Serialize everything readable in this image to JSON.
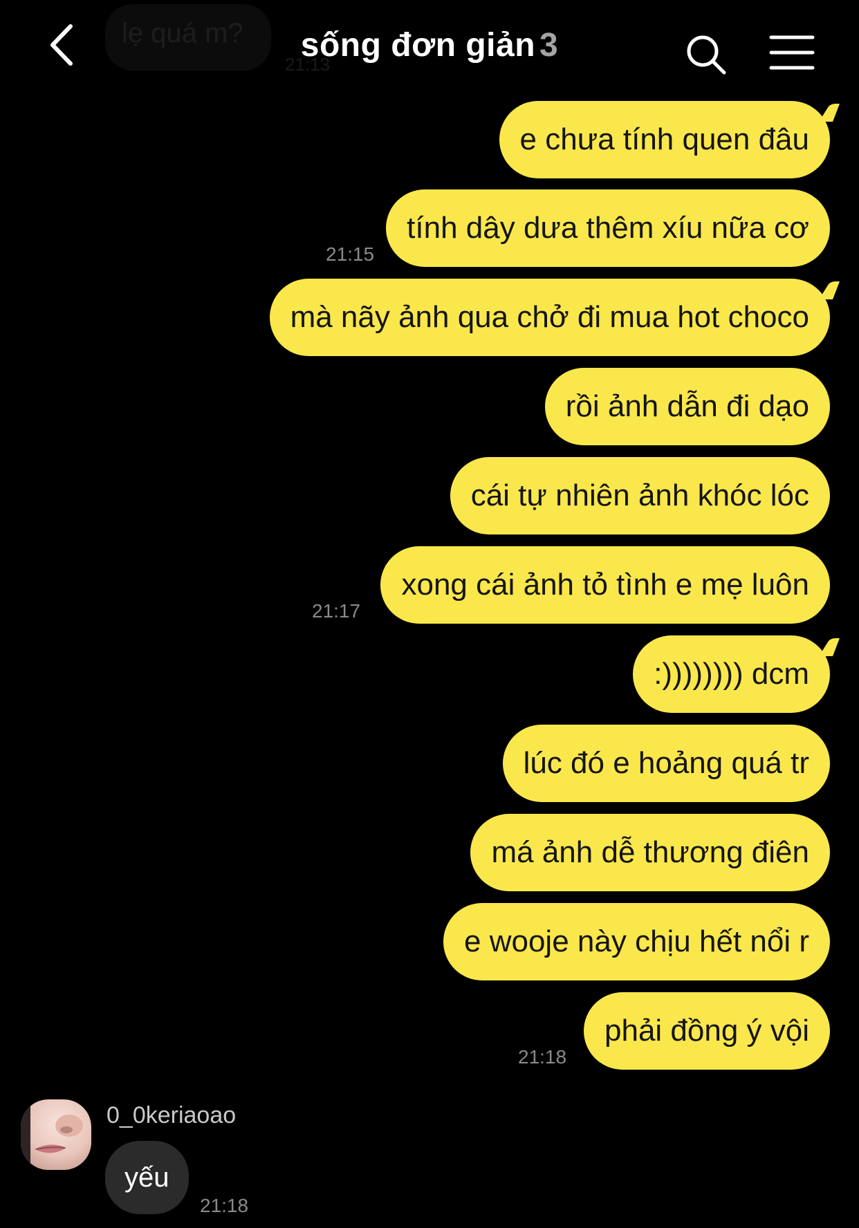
{
  "header": {
    "title": "sống đơn giản",
    "member_count": "3",
    "ghost_preview": "lẹ quá m?",
    "ghost_time": "21:13"
  },
  "messages": [
    {
      "text": "e chưa tính quen đâu",
      "time": ""
    },
    {
      "text": "tính dây dưa thêm xíu nữa cơ",
      "time": "21:15"
    },
    {
      "text": "mà nãy ảnh qua chở đi mua hot choco",
      "time": ""
    },
    {
      "text": "rồi ảnh dẫn đi dạo",
      "time": ""
    },
    {
      "text": "cái tự nhiên ảnh khóc lóc",
      "time": ""
    },
    {
      "text": "xong cái ảnh tỏ tình e mẹ luôn",
      "time": "21:17"
    },
    {
      "text": ":)))))))) dcm",
      "time": ""
    },
    {
      "text": "lúc đó e hoảng quá tr",
      "time": ""
    },
    {
      "text": "má ảnh dễ thương điên",
      "time": ""
    },
    {
      "text": "e wooje này chịu hết nổi r",
      "time": ""
    },
    {
      "text": "phải đồng ý vội",
      "time": "21:18"
    }
  ],
  "incoming": {
    "sender": "0_0keriaoao",
    "text": "yếu",
    "time": "21:18"
  },
  "colors": {
    "outgoing_bubble": "#fae74c",
    "incoming_bubble": "#2b2b2b",
    "background": "#000000"
  }
}
